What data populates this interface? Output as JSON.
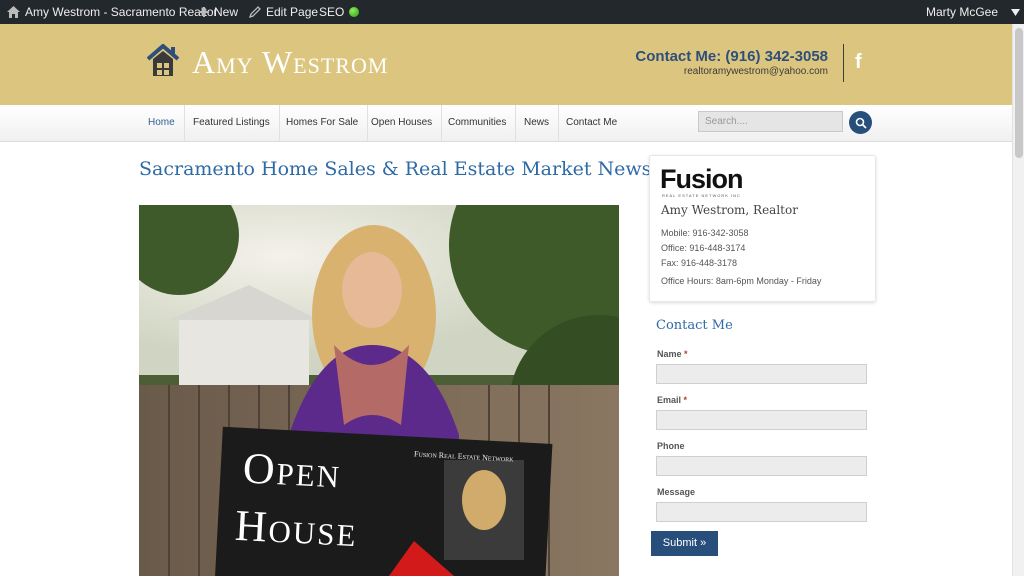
{
  "adminbar": {
    "site_name": "Amy Westrom - Sacramento Realtor",
    "new_label": "New",
    "edit_label": "Edit Page",
    "seo_label": "SEO",
    "user_name": "Marty McGee",
    "icons": {
      "home": "home-icon",
      "new": "plus-icon",
      "edit": "pencil-icon",
      "seo": "green-status-dot",
      "user": "triangle-down-icon"
    }
  },
  "header": {
    "logo_text": "Amy Westrom",
    "contact_line": "Contact Me: (916) 342-3058",
    "email": "realtoramywestrom@yahoo.com",
    "social_icon": "facebook-icon",
    "colors": {
      "bg": "#dcc67f",
      "contact": "#2e4f7a"
    }
  },
  "nav": {
    "items": [
      {
        "label": "Home",
        "active": true
      },
      {
        "label": "Featured Listings"
      },
      {
        "label": "Homes For Sale"
      },
      {
        "label": "Open Houses"
      },
      {
        "label": "Communities"
      },
      {
        "label": "News"
      },
      {
        "label": "Contact Me"
      }
    ],
    "search_placeholder": "Search....",
    "search_icon": "magnifier-icon",
    "accent": "#284e7c"
  },
  "main": {
    "title": "Sacramento Home Sales & Real Estate Market News",
    "photo": {
      "sign_line1": "Open",
      "sign_line2": "House",
      "sign_brand": "Fusion Real Estate Network"
    }
  },
  "sidebar": {
    "card": {
      "brand": "Fusion",
      "brand_sub": "REAL ESTATE NETWORK INC",
      "agent": "Amy Westrom, Realtor",
      "mobile": "Mobile: 916-342-3058",
      "office": "Office: 916-448-3174",
      "fax": "Fax: 916-448-3178",
      "hours": "Office Hours: 8am-6pm Monday - Friday"
    },
    "contact_form": {
      "title": "Contact Me",
      "name_label": "Name",
      "email_label": "Email",
      "phone_label": "Phone",
      "message_label": "Message",
      "required_mark": "*",
      "submit_label": "Submit »"
    }
  }
}
